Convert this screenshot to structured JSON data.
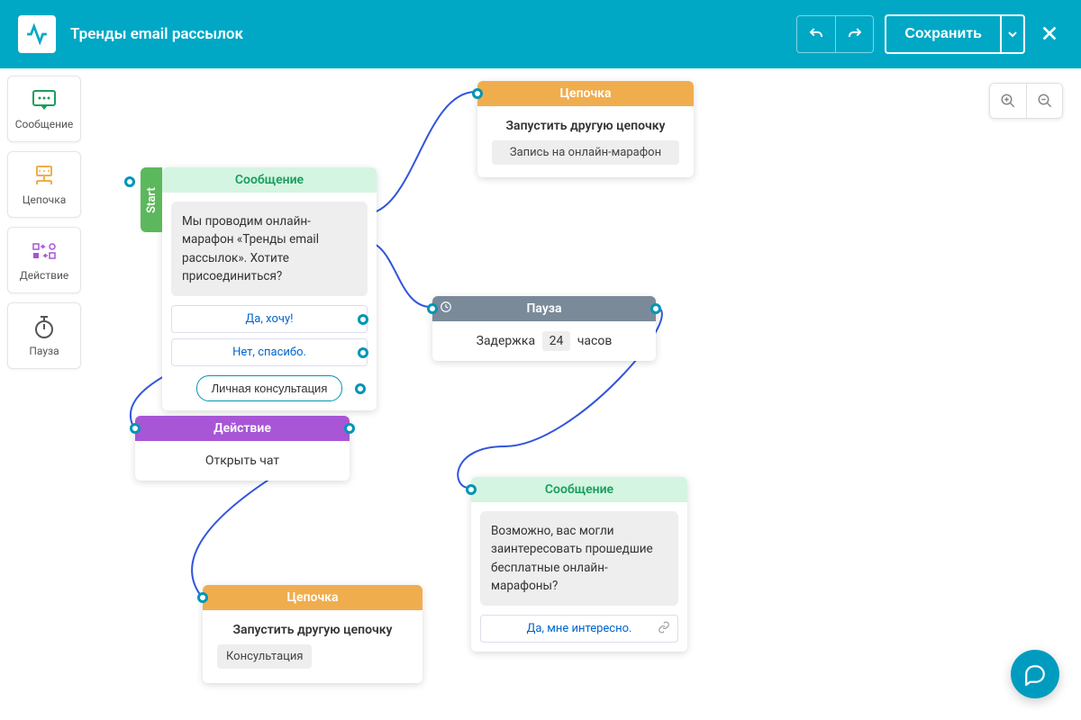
{
  "header": {
    "title": "Тренды email рассылок",
    "save": "Сохранить"
  },
  "sidebar": [
    {
      "label": "Сообщение",
      "color": "#1a9e5c"
    },
    {
      "label": "Цепочка",
      "color": "#f0ad4e"
    },
    {
      "label": "Действие",
      "color": "#a855d6"
    },
    {
      "label": "Пауза",
      "color": "#666"
    }
  ],
  "nodes": {
    "start_label": "Start",
    "n1": {
      "header": "Сообщение",
      "message": "Мы проводим онлайн-марафон «Тренды email рассылок». Хотите присоединиться?",
      "options": [
        "Да, хочу!",
        "Нет, спасибо."
      ],
      "button": "Личная консультация"
    },
    "n2": {
      "header": "Цепочка",
      "run": "Запустить другую цепочку",
      "pill": "Запись на онлайн-марафон"
    },
    "n3": {
      "header": "Пауза",
      "delay_prefix": "Задержка",
      "delay_value": "24",
      "delay_suffix": "часов"
    },
    "n4": {
      "header": "Действие",
      "content": "Открыть чат"
    },
    "n5": {
      "header": "Сообщение",
      "message": "Возможно, вас могли заинтересовать прошедшие бесплатные онлайн-марафоны?",
      "option": "Да, мне интересно."
    },
    "n6": {
      "header": "Цепочка",
      "run": "Запустить другую цепочку",
      "pill": "Консультация"
    }
  }
}
